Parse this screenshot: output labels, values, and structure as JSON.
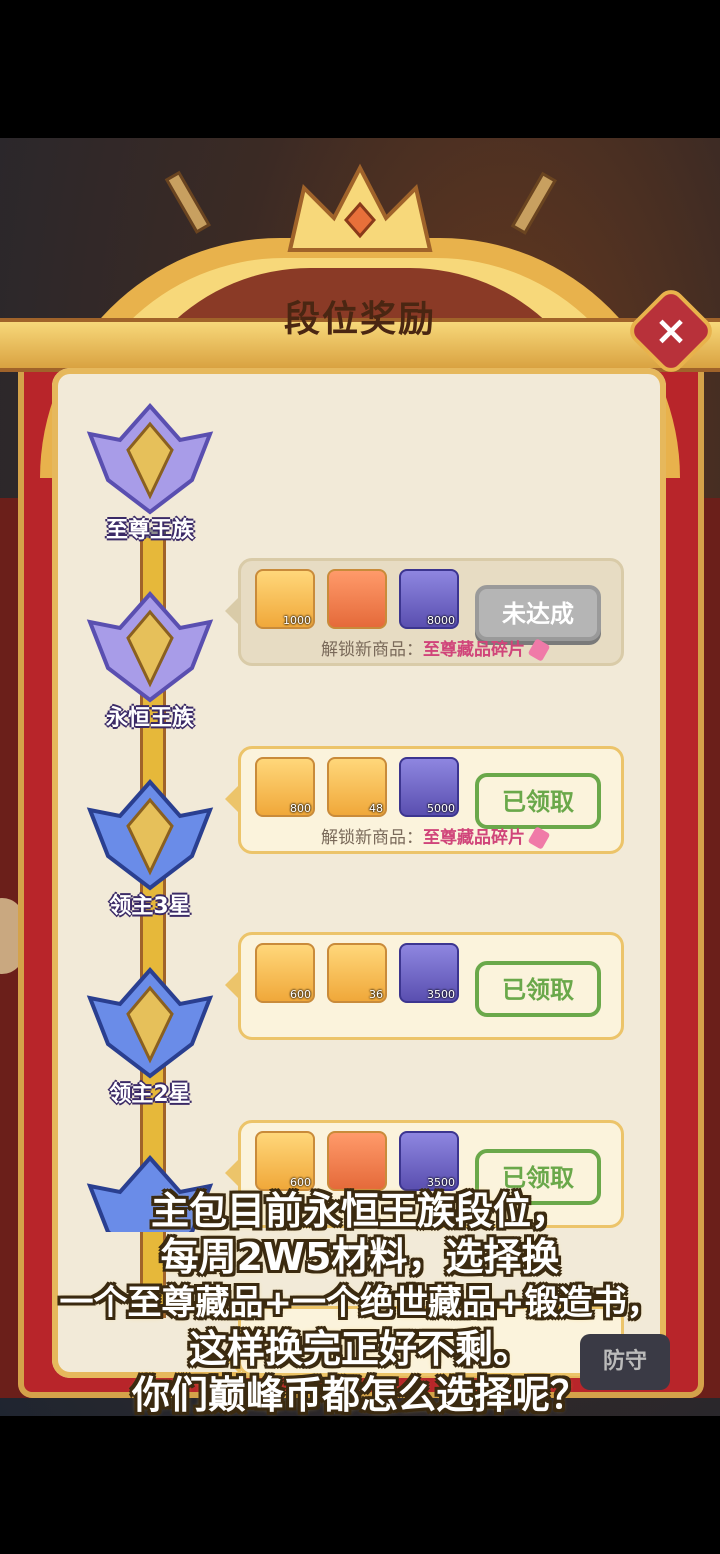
{
  "panel": {
    "title": "段位奖励",
    "close_label": "×"
  },
  "ranks": [
    {
      "name": "至尊王族",
      "status": "pending",
      "button_label": "未达成",
      "rewards": [
        {
          "icon": "diamond-icon",
          "qty": "1000"
        },
        {
          "icon": "treasure-chest-icon",
          "qty": ""
        },
        {
          "icon": "trophy-coin-icon",
          "qty": "8000"
        }
      ],
      "unlock_prefix": "解锁新商品：",
      "unlock_item": "至尊藏品碎片"
    },
    {
      "name": "永恒王族",
      "status": "claimed",
      "button_label": "已领取",
      "rewards": [
        {
          "icon": "diamond-icon",
          "qty": "800"
        },
        {
          "icon": "golden-egg-icon",
          "qty": "48"
        },
        {
          "icon": "trophy-coin-icon",
          "qty": "5000"
        }
      ],
      "unlock_prefix": "解锁新商品：",
      "unlock_item": "至尊藏品碎片"
    },
    {
      "name": "领主3星",
      "status": "claimed",
      "button_label": "已领取",
      "rewards": [
        {
          "icon": "diamond-icon",
          "qty": "600"
        },
        {
          "icon": "golden-egg-icon",
          "qty": "36"
        },
        {
          "icon": "trophy-coin-icon",
          "qty": "3500"
        }
      ]
    },
    {
      "name": "领主2星",
      "status": "claimed",
      "button_label": "已领取",
      "rewards": [
        {
          "icon": "diamond-icon",
          "qty": "600"
        },
        {
          "icon": "treasure-chest-icon",
          "qty": ""
        },
        {
          "icon": "trophy-coin-icon",
          "qty": "3500"
        }
      ]
    }
  ],
  "bottom_button": "防守",
  "subtitle": [
    "主包目前永恒王族段位，",
    "每周2W5材料，选择换",
    "一个至尊藏品+一个绝世藏品+锻造书，",
    "这样换完正好不剩。",
    "你们巅峰币都怎么选择呢？"
  ],
  "colors": {
    "frame_red": "#b8252a",
    "gold": "#e8b24c",
    "claimed_green": "#6aa84a",
    "highlight_pink": "#d0457a"
  }
}
